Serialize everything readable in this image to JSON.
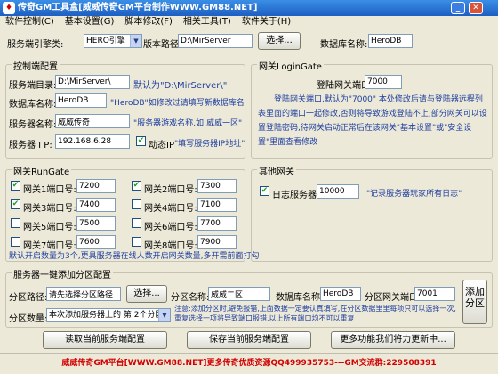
{
  "window": {
    "title": "传奇GM工具盒[威威传奇GM平台制作WWW.GM88.NET]",
    "icon": "gm-app-icon"
  },
  "menu": [
    "软件控制(C)",
    "基本设置(G)",
    "脚本修改(F)",
    "相关工具(T)",
    "软件关于(H)"
  ],
  "top": {
    "engine_label": "服务端引擎类:",
    "engine_value": "HERO引擎",
    "path_label": "版本路径:",
    "path_value": "D:\\MirServer",
    "browse_label": "选择...",
    "dbname_label": "数据库名称:",
    "dbname_value": "HeroDB"
  },
  "control": {
    "title": "控制端配置",
    "server_dir_label": "服务端目录:",
    "server_dir_value": "D:\\MirServer\\",
    "server_dir_hint": "默认为\"D:\\MirServer\\\"",
    "db_label": "数据库名称:",
    "db_value": "HeroDB",
    "db_hint": "\"HeroDB\"如修改过请填写新数据库名",
    "name_label": "服务器名称:",
    "name_value": "威威传奇",
    "name_hint": "\"服务器游戏名称,如:威威一区\"",
    "ip_label": "服务器 I P:",
    "ip_value": "192.168.6.28",
    "dynamic_ip_label": "动态IP",
    "dynamic_ip_checked": true,
    "ip_hint": "\"填写服务器IP地址\""
  },
  "login": {
    "title": "网关LoginGate",
    "port_label": "登陆网关端口:",
    "port_value": "7000",
    "desc": "登陆网关端口,默认为\"7000\" 本处修改后请与登陆器远程列表里面的端口一起修改,否则将导致游戏登陆不上,部分网关可以设置登陆密码,待网关启动正常后在该网关\"基本设置\"或\"安全设置\"里面查看修改"
  },
  "rungate": {
    "title": "网关RunGate",
    "ports": [
      {
        "label": "网关1端口号:",
        "value": "7200",
        "checked": true
      },
      {
        "label": "网关2端口号:",
        "value": "7300",
        "checked": true
      },
      {
        "label": "网关3端口号:",
        "value": "7400",
        "checked": true
      },
      {
        "label": "网关4端口号:",
        "value": "7100",
        "checked": false
      },
      {
        "label": "网关5端口号:",
        "value": "7500",
        "checked": false
      },
      {
        "label": "网关6端口号:",
        "value": "7700",
        "checked": false
      },
      {
        "label": "网关7端口号:",
        "value": "7600",
        "checked": false
      },
      {
        "label": "网关8端口号:",
        "value": "7900",
        "checked": false
      }
    ],
    "hint": "默认开启数量为3个,更具服务器在线人数开启网关数量,多开需前面打勾"
  },
  "other": {
    "title": "其他网关",
    "log_label": "日志服务器:",
    "log_checked": true,
    "log_value": "10000",
    "log_hint": "\"记录服务器玩家所有日志\""
  },
  "zone": {
    "title": "服务器一键添加分区配置",
    "path_label": "分区路径:",
    "path_value": "请先选择分区路径",
    "browse_label": "选择...",
    "name_label": "分区名称:",
    "name_value": "威威二区",
    "db_label": "数据库名称:",
    "db_value": "HeroDB",
    "gate_label": "分区网关端口:",
    "gate_value": "7001",
    "count_label": "分区数量:",
    "count_value": "本次添加服务器上的 第 2个分区",
    "note": "注意:添加分区时,避免报错,上面数据一定要认真填写,在分区数据里里每项只可以选择一次,重复选择一项将导致端口报错,以上所有端口均不可以重复",
    "add_label": "添加分区"
  },
  "buttons": {
    "read": "读取当前服务端配置",
    "save": "保存当前服务端配置",
    "more": "更多功能我们将力更新中..."
  },
  "status": "威威传奇GM平台[WWW.GM88.NET]更多传奇优质资源QQ499935753---GM交流群:229508391",
  "colors": {
    "hint": "#1f3fa0",
    "status": "#d40000",
    "title_bar": "#1d5fc2"
  }
}
